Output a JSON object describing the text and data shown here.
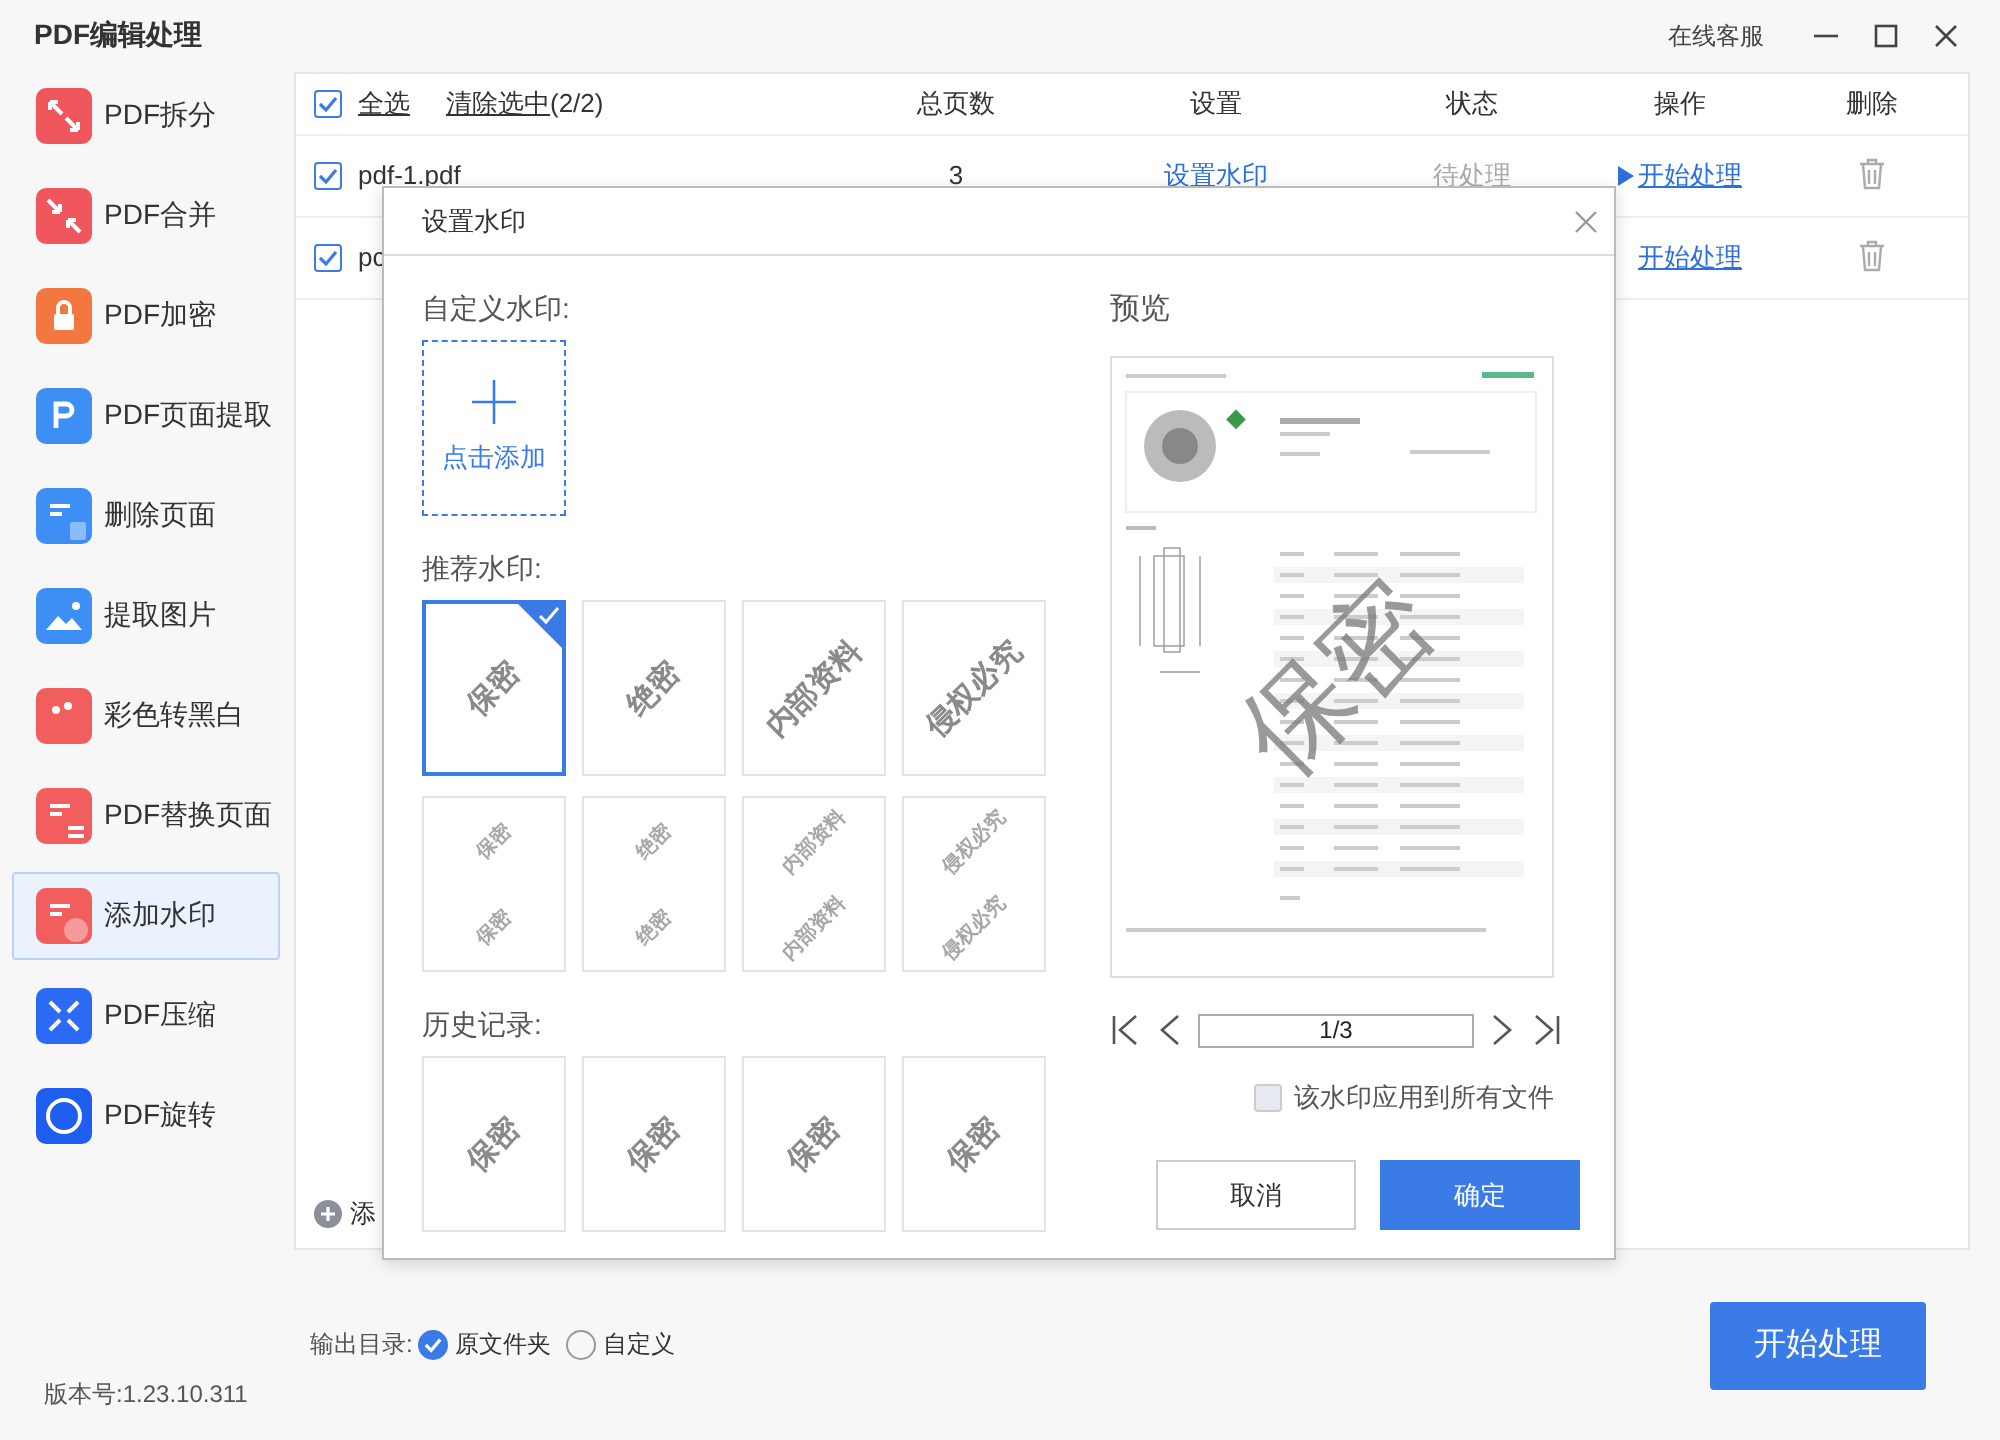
{
  "app": {
    "title": "PDF编辑处理",
    "support": "在线客服",
    "version": "版本号:1.23.10.311"
  },
  "sidebar": {
    "items": [
      {
        "label": "PDF拆分",
        "selected": false
      },
      {
        "label": "PDF合并",
        "selected": false
      },
      {
        "label": "PDF加密",
        "selected": false
      },
      {
        "label": "PDF页面提取",
        "selected": false
      },
      {
        "label": "删除页面",
        "selected": false
      },
      {
        "label": "提取图片",
        "selected": false
      },
      {
        "label": "彩色转黑白",
        "selected": false
      },
      {
        "label": "PDF替换页面",
        "selected": false
      },
      {
        "label": "添加水印",
        "selected": true
      },
      {
        "label": "PDF压缩",
        "selected": false
      },
      {
        "label": "PDF旋转",
        "selected": false
      }
    ]
  },
  "table": {
    "select_all": {
      "label": "全选",
      "checked": true
    },
    "clear_label": "清除选中",
    "clear_count": "(2/2)",
    "columns": [
      "总页数",
      "设置",
      "状态",
      "操作",
      "删除"
    ],
    "rows": [
      {
        "checked": true,
        "name": "pdf-1.pdf",
        "pages": "3",
        "setting": "设置水印",
        "status": "待处理",
        "action": "开始处理"
      },
      {
        "checked": true,
        "name": "pc",
        "action": "开始处理"
      }
    ],
    "add_file": "添"
  },
  "output": {
    "label": "输出目录:",
    "options": [
      {
        "label": "原文件夹",
        "selected": true
      },
      {
        "label": "自定义",
        "selected": false
      }
    ]
  },
  "start_button": "开始处理",
  "dialog": {
    "title": "设置水印",
    "custom_label": "自定义水印:",
    "add_label": "点击添加",
    "recommended_label": "推荐水印:",
    "recommended": [
      {
        "text": "保密",
        "kind": "single",
        "selected": true
      },
      {
        "text": "绝密",
        "kind": "single",
        "selected": false
      },
      {
        "text": "内部资料",
        "kind": "single",
        "selected": false
      },
      {
        "text": "侵权必究",
        "kind": "single",
        "selected": false
      },
      {
        "texts": [
          "保密",
          "保密"
        ],
        "kind": "tiled",
        "selected": false
      },
      {
        "texts": [
          "绝密",
          "绝密"
        ],
        "kind": "tiled",
        "selected": false
      },
      {
        "texts": [
          "内部资料",
          "内部资料"
        ],
        "kind": "tiled",
        "selected": false
      },
      {
        "texts": [
          "侵权必究",
          "侵权必究"
        ],
        "kind": "tiled",
        "selected": false
      }
    ],
    "history_label": "历史记录:",
    "history": [
      {
        "text": "保密"
      },
      {
        "text": "保密"
      },
      {
        "text": "保密"
      },
      {
        "text": "保密"
      }
    ],
    "preview_label": "预览",
    "preview_watermark": "保密",
    "page": "1/3",
    "apply_all": {
      "label": "该水印应用到所有文件",
      "checked": false
    },
    "cancel": "取消",
    "ok": "确定"
  }
}
